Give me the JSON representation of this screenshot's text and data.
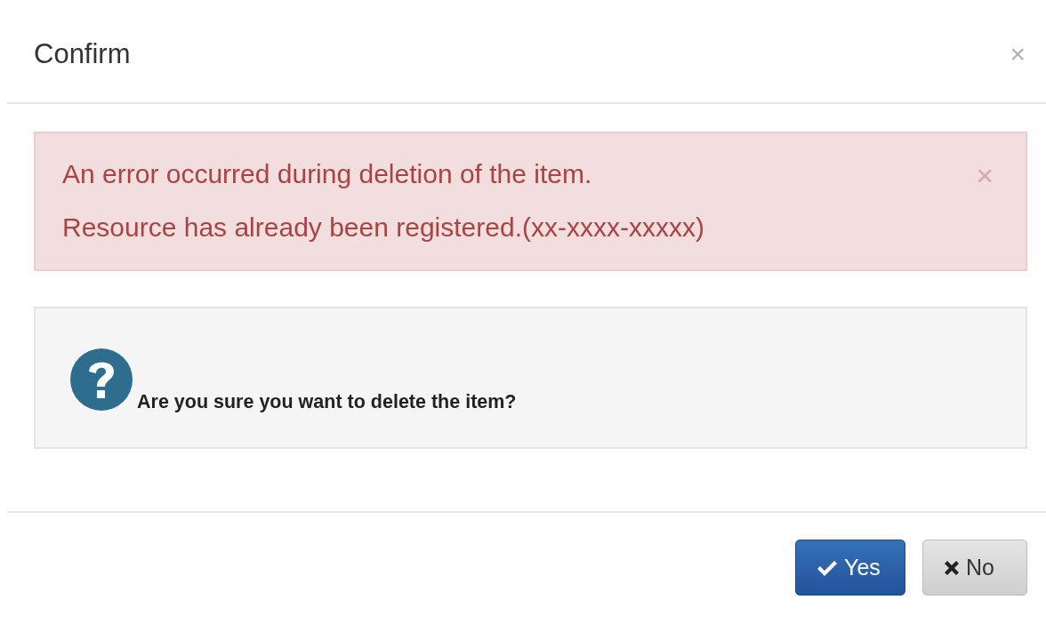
{
  "dialog": {
    "title": "Confirm",
    "close": "×"
  },
  "alert": {
    "kind": "error",
    "lines": [
      "An error occurred during deletion of the item.",
      "Resource has already been registered.(xx-xxxx-xxxxx)"
    ],
    "close": "×"
  },
  "question": {
    "text": "Are you sure you want to delete the item?"
  },
  "buttons": [
    {
      "label": "Yes",
      "kind": "primary"
    },
    {
      "label": "No",
      "kind": "default"
    }
  ]
}
